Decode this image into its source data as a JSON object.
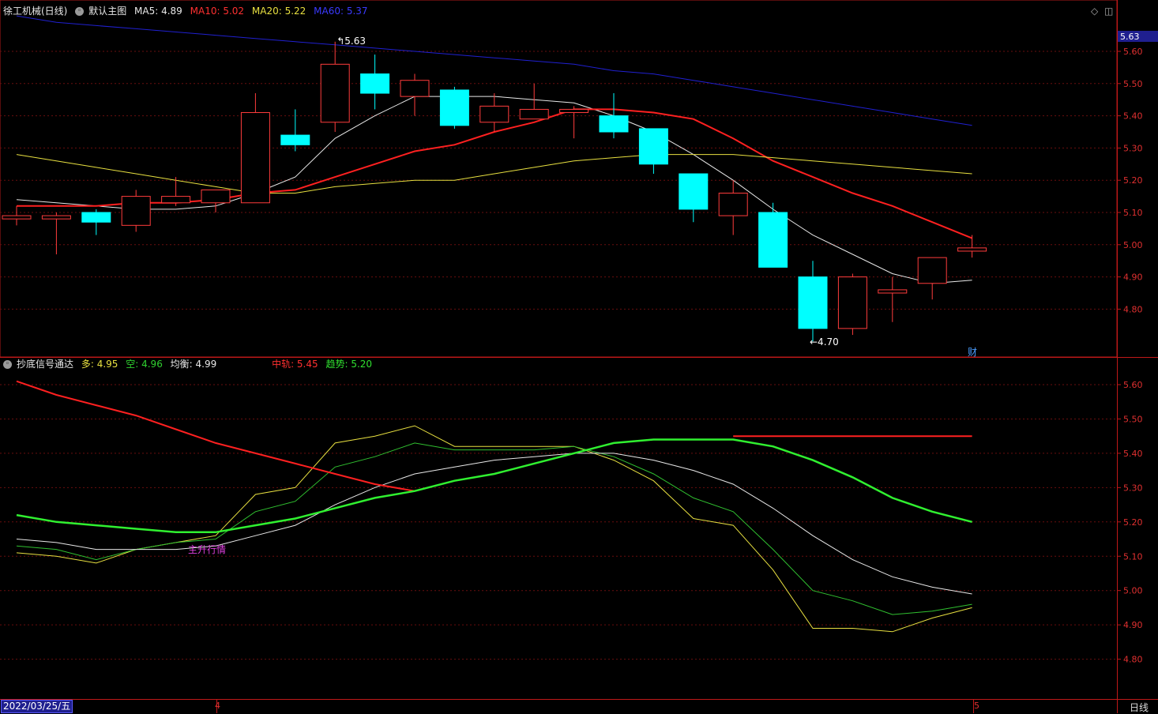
{
  "window": {
    "stock_name": "徐工机械(日线)",
    "main_chart_label": "默认主图",
    "date_tag": "2022/03/25/五",
    "period_label": "日线",
    "finance_tag": "财",
    "price_tag": "5.63"
  },
  "main_legend": [
    {
      "label": "MA5: 4.89",
      "color": "#e8e8e8"
    },
    {
      "label": "MA10: 5.02",
      "color": "#ff3030"
    },
    {
      "label": "MA20: 5.22",
      "color": "#e8e040"
    },
    {
      "label": "MA60: 5.37",
      "color": "#3030ff"
    }
  ],
  "sub_legend": {
    "title": "抄底信号通达",
    "items": [
      {
        "label": "多: 4.95",
        "color": "#e8e040"
      },
      {
        "label": "空: 4.96",
        "color": "#30d030"
      },
      {
        "label": "均衡: 4.99",
        "color": "#e8e8e8"
      },
      {
        "label": "中轨: 5.45",
        "color": "#ff3030"
      },
      {
        "label": "趋势: 5.20",
        "color": "#30e030"
      }
    ],
    "signal_text": "主升行情"
  },
  "x_ticks": [
    "4",
    "5"
  ],
  "colors": {
    "up": "#ff3c3c",
    "down": "#00ffff",
    "axis": "#b01818",
    "grid": "#7a1010",
    "ma5": "#e8e8e8",
    "ma10": "#ff2020",
    "ma20": "#e8e040",
    "ma60": "#2020d0"
  },
  "chart_data": [
    {
      "type": "candlestick",
      "title": "徐工机械(日线)",
      "ylim": [
        4.7,
        5.66
      ],
      "y_ticks": [
        "5.60",
        "5.50",
        "5.40",
        "5.30",
        "5.20",
        "5.10",
        "5.00",
        "4.90",
        "4.80"
      ],
      "annotations": [
        {
          "label": "5.63"
        },
        {
          "label": "4.70"
        }
      ],
      "candles": [
        {
          "open": 5.08,
          "close": 5.09,
          "high": 5.12,
          "low": 5.06
        },
        {
          "open": 5.08,
          "close": 5.09,
          "high": 5.1,
          "low": 4.97
        },
        {
          "open": 5.1,
          "close": 5.07,
          "high": 5.11,
          "low": 5.03
        },
        {
          "open": 5.06,
          "close": 5.15,
          "high": 5.17,
          "low": 5.04
        },
        {
          "open": 5.13,
          "close": 5.15,
          "high": 5.21,
          "low": 5.12
        },
        {
          "open": 5.13,
          "close": 5.17,
          "high": 5.17,
          "low": 5.1
        },
        {
          "open": 5.13,
          "close": 5.41,
          "high": 5.47,
          "low": 5.13
        },
        {
          "open": 5.34,
          "close": 5.31,
          "high": 5.42,
          "low": 5.29
        },
        {
          "open": 5.38,
          "close": 5.56,
          "high": 5.63,
          "low": 5.35
        },
        {
          "open": 5.53,
          "close": 5.47,
          "high": 5.59,
          "low": 5.42
        },
        {
          "open": 5.46,
          "close": 5.51,
          "high": 5.53,
          "low": 5.4
        },
        {
          "open": 5.48,
          "close": 5.37,
          "high": 5.49,
          "low": 5.36
        },
        {
          "open": 5.38,
          "close": 5.43,
          "high": 5.47,
          "low": 5.35
        },
        {
          "open": 5.39,
          "close": 5.42,
          "high": 5.5,
          "low": 5.39
        },
        {
          "open": 5.41,
          "close": 5.42,
          "high": 5.43,
          "low": 5.33
        },
        {
          "open": 5.4,
          "close": 5.35,
          "high": 5.47,
          "low": 5.33
        },
        {
          "open": 5.36,
          "close": 5.25,
          "high": 5.36,
          "low": 5.22
        },
        {
          "open": 5.22,
          "close": 5.11,
          "high": 5.22,
          "low": 5.07
        },
        {
          "open": 5.09,
          "close": 5.16,
          "high": 5.2,
          "low": 5.03
        },
        {
          "open": 5.1,
          "close": 4.93,
          "high": 5.13,
          "low": 4.93
        },
        {
          "open": 4.9,
          "close": 4.74,
          "high": 4.95,
          "low": 4.7
        },
        {
          "open": 4.74,
          "close": 4.9,
          "high": 4.91,
          "low": 4.72
        },
        {
          "open": 4.85,
          "close": 4.86,
          "high": 4.9,
          "low": 4.76
        },
        {
          "open": 4.88,
          "close": 4.96,
          "high": 4.96,
          "low": 4.83
        },
        {
          "open": 4.98,
          "close": 4.99,
          "high": 5.03,
          "low": 4.96
        }
      ],
      "series": [
        {
          "name": "MA5",
          "values": [
            5.14,
            5.13,
            5.12,
            5.11,
            5.11,
            5.12,
            5.16,
            5.21,
            5.33,
            5.4,
            5.46,
            5.46,
            5.46,
            5.45,
            5.44,
            5.4,
            5.35,
            5.28,
            5.2,
            5.11,
            5.03,
            4.97,
            4.91,
            4.88,
            4.89
          ]
        },
        {
          "name": "MA10",
          "values": [
            5.12,
            5.12,
            5.12,
            5.13,
            5.13,
            5.14,
            5.16,
            5.17,
            5.21,
            5.25,
            5.29,
            5.31,
            5.35,
            5.38,
            5.42,
            5.42,
            5.41,
            5.39,
            5.33,
            5.26,
            5.21,
            5.16,
            5.12,
            5.07,
            5.02
          ]
        },
        {
          "name": "MA20",
          "values": [
            5.28,
            5.26,
            5.24,
            5.22,
            5.2,
            5.18,
            5.16,
            5.16,
            5.18,
            5.19,
            5.2,
            5.2,
            5.22,
            5.24,
            5.26,
            5.27,
            5.28,
            5.28,
            5.28,
            5.27,
            5.26,
            5.25,
            5.24,
            5.23,
            5.22
          ]
        },
        {
          "name": "MA60",
          "values": [
            5.71,
            5.69,
            5.68,
            5.67,
            5.66,
            5.65,
            5.64,
            5.63,
            5.62,
            5.61,
            5.6,
            5.59,
            5.58,
            5.57,
            5.56,
            5.54,
            5.53,
            5.51,
            5.49,
            5.47,
            5.45,
            5.43,
            5.41,
            5.39,
            5.37
          ]
        }
      ]
    },
    {
      "type": "line",
      "title": "抄底信号通达",
      "ylim": [
        4.71,
        5.7
      ],
      "y_ticks": [
        "5.60",
        "5.50",
        "5.40",
        "5.30",
        "5.20",
        "5.10",
        "5.00",
        "4.90",
        "4.80"
      ],
      "series": [
        {
          "name": "多",
          "values": [
            5.11,
            5.1,
            5.08,
            5.12,
            5.14,
            5.16,
            5.28,
            5.3,
            5.43,
            5.45,
            5.48,
            5.42,
            5.42,
            5.42,
            5.42,
            5.38,
            5.32,
            5.21,
            5.19,
            5.06,
            4.89,
            4.89,
            4.88,
            4.92,
            4.95
          ]
        },
        {
          "name": "空",
          "values": [
            5.13,
            5.12,
            5.09,
            5.12,
            5.14,
            5.15,
            5.23,
            5.26,
            5.36,
            5.39,
            5.43,
            5.41,
            5.41,
            5.41,
            5.42,
            5.39,
            5.34,
            5.27,
            5.23,
            5.12,
            5.0,
            4.97,
            4.93,
            4.94,
            4.96
          ]
        },
        {
          "name": "均衡",
          "values": [
            5.15,
            5.14,
            5.12,
            5.12,
            5.12,
            5.13,
            5.16,
            5.19,
            5.25,
            5.3,
            5.34,
            5.36,
            5.38,
            5.39,
            5.4,
            5.4,
            5.38,
            5.35,
            5.31,
            5.24,
            5.16,
            5.09,
            5.04,
            5.01,
            4.99
          ]
        },
        {
          "name": "中轨",
          "values": [
            5.61,
            5.57,
            5.54,
            5.51,
            5.47,
            5.43,
            5.4,
            5.37,
            5.34,
            5.31,
            5.29,
            null,
            null,
            null,
            null,
            null,
            null,
            null,
            5.45,
            5.45,
            5.45,
            5.45,
            5.45,
            5.45,
            5.45
          ]
        },
        {
          "name": "趋势",
          "values": [
            5.22,
            5.2,
            5.19,
            5.18,
            5.17,
            5.17,
            5.19,
            5.21,
            5.24,
            5.27,
            5.29,
            5.32,
            5.34,
            5.37,
            5.4,
            5.43,
            5.44,
            5.44,
            5.44,
            5.42,
            5.38,
            5.33,
            5.27,
            5.23,
            5.2
          ]
        }
      ]
    }
  ]
}
